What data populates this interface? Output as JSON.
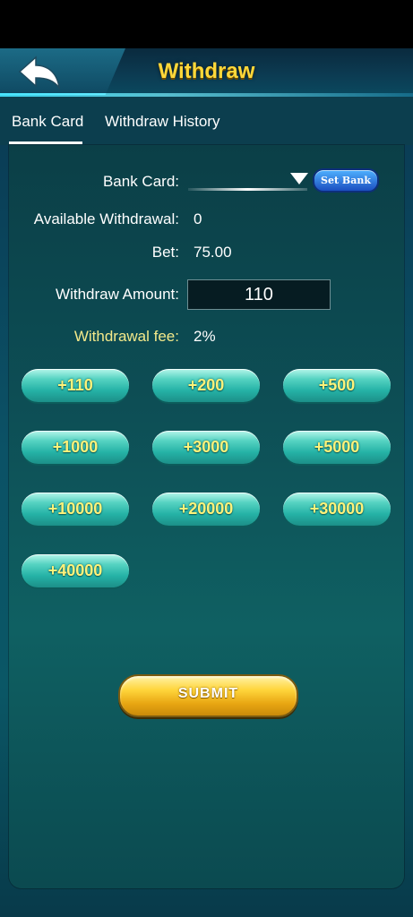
{
  "header": {
    "title": "Withdraw"
  },
  "tabs": [
    {
      "label": "Bank Card",
      "active": true
    },
    {
      "label": "Withdraw History",
      "active": false
    }
  ],
  "form": {
    "bank_card_label": "Bank Card:",
    "set_bank_label": "Set Bank",
    "available_label": "Available Withdrawal:",
    "available_value": "0",
    "bet_label": "Bet:",
    "bet_value": "75.00",
    "amount_label": "Withdraw Amount:",
    "amount_value": "110",
    "fee_label": "Withdrawal fee:",
    "fee_value": "2%"
  },
  "quick_amounts": [
    "+110",
    "+200",
    "+500",
    "+1000",
    "+3000",
    "+5000",
    "+10000",
    "+20000",
    "+30000",
    "+40000"
  ],
  "submit_label": "SUBMIT",
  "colors": {
    "title": "#ffd83a",
    "panel": "#0d4e55",
    "quick_button": "#25b2a6",
    "quick_text": "#fff27a",
    "submit": "#ffd53b",
    "fee_label": "#f3e98a"
  }
}
